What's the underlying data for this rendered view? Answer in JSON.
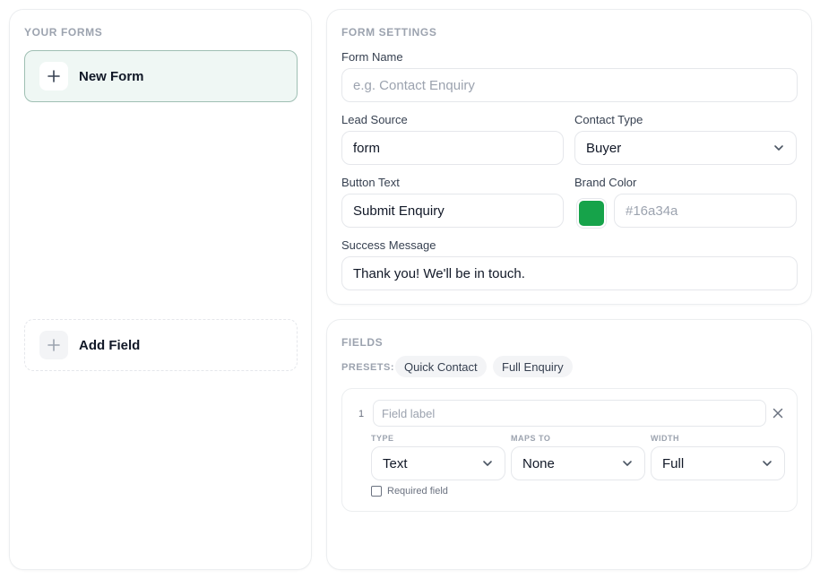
{
  "left": {
    "forms_title": "YOUR FORMS",
    "new_form_label": "New Form",
    "add_field_label": "Add Field"
  },
  "settings": {
    "title": "FORM SETTINGS",
    "form_name_label": "Form Name",
    "form_name_placeholder": "e.g. Contact Enquiry",
    "lead_source_label": "Lead Source",
    "lead_source_value": "form",
    "contact_type_label": "Contact Type",
    "contact_type_value": "Buyer",
    "button_text_label": "Button Text",
    "button_text_value": "Submit Enquiry",
    "brand_color_label": "Brand Color",
    "brand_color_value": "#16a34a",
    "success_message_label": "Success Message",
    "success_message_value": "Thank you! We'll be in touch."
  },
  "fields": {
    "title": "FIELDS",
    "presets_label": "PRESETS:",
    "presets": [
      "Quick Contact",
      "Full Enquiry"
    ],
    "items": [
      {
        "index": "1",
        "label_placeholder": "Field label",
        "type_label": "TYPE",
        "type_value": "Text",
        "maps_to_label": "MAPS TO",
        "maps_to_value": "None",
        "width_label": "WIDTH",
        "width_value": "Full",
        "required_label": "Required field"
      }
    ]
  },
  "colors": {
    "accent_bg": "#eff7f4",
    "accent_border": "#9fbfb3",
    "brand": "#16a34a"
  },
  "icons": [
    "plus-icon",
    "chevron-down-icon",
    "close-icon"
  ]
}
